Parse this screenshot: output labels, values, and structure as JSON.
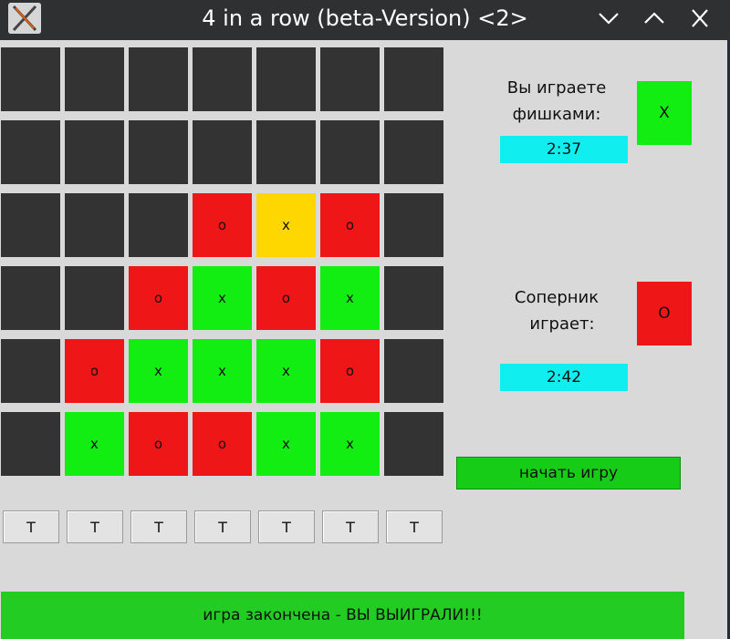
{
  "window": {
    "title": "4 in a row (beta-Version) <2>",
    "app_icon": "x-logo-icon",
    "controls": [
      "minimize-chevron-icon",
      "maximize-chevron-icon",
      "close-icon"
    ]
  },
  "board": {
    "rows": [
      [
        "",
        "",
        "",
        "",
        "",
        "",
        ""
      ],
      [
        "",
        "",
        "",
        "",
        "",
        "",
        ""
      ],
      [
        "",
        "",
        "",
        "o",
        "x",
        "o",
        ""
      ],
      [
        "",
        "",
        "o",
        "x",
        "o",
        "x",
        ""
      ],
      [
        "",
        "o",
        "x",
        "x",
        "x",
        "o",
        ""
      ],
      [
        "",
        "x",
        "o",
        "o",
        "x",
        "x",
        ""
      ]
    ],
    "highlight": {
      "row": 2,
      "col": 4
    },
    "colors": {
      "empty": "#333333",
      "x": "#12ee12",
      "o": "#ee1616",
      "highlight": "#ffd700"
    }
  },
  "drop_buttons": [
    "T",
    "T",
    "T",
    "T",
    "T",
    "T",
    "T"
  ],
  "player": {
    "label_line1": "Вы играете",
    "label_line2": "фишками:",
    "chip": "X",
    "chip_color": "#12ee12",
    "timer": "2:37"
  },
  "opponent": {
    "label_line1": "Соперник",
    "label_line2": "играет:",
    "chip": "O",
    "chip_color": "#ee1616",
    "timer": "2:42"
  },
  "start_button": {
    "label": "начать игру"
  },
  "status": {
    "text": "игра закончена - ВЫ ВЫИГРАЛИ!!!"
  }
}
